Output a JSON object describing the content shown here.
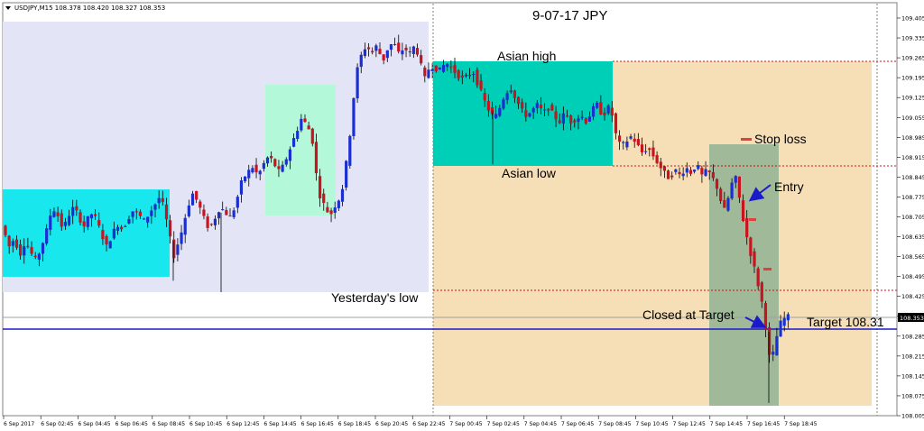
{
  "header": {
    "symbol_line": "USDJPY,M15  108.378 108.420 108.327 108.353",
    "title": "9-07-17  JPY"
  },
  "colors": {
    "bull_candle": "#1a2fd0",
    "bear_candle": "#c8141e",
    "prev_session": "#e4e4f7",
    "prev_asian": "#19e7ee",
    "prev_box2": "#b4f8da",
    "asian_box": "#00cfb7",
    "day_zone": "#f6dfb6",
    "trade_box": "#9fb999",
    "level_line": "#d01010",
    "target_line": "#1a1ac8"
  },
  "annotations": {
    "asian_high": "Asian high",
    "asian_low": "Asian low",
    "yesterdays_low": "Yesterday's low",
    "stop_loss": "Stop loss",
    "entry": "Entry",
    "closed_at_target": "Closed at Target",
    "target": "Target  108.31"
  },
  "chart_data": {
    "type": "candlestick",
    "title": "9-07-17  JPY",
    "symbol": "USDJPY,M15",
    "ylim": [
      108.0,
      109.38
    ],
    "y_ticks": [
      "109.405",
      "109.335",
      "109.265",
      "109.195",
      "109.125",
      "109.055",
      "108.985",
      "108.915",
      "108.845",
      "108.775",
      "108.705",
      "108.635",
      "108.565",
      "108.495",
      "108.425",
      "108.353",
      "108.285",
      "108.215",
      "108.145",
      "108.075",
      "108.005"
    ],
    "current_price_label": "108.353",
    "x_ticks": [
      "6 Sep 2017",
      "6 Sep 02:45",
      "6 Sep 04:45",
      "6 Sep 06:45",
      "6 Sep 08:45",
      "6 Sep 10:45",
      "6 Sep 12:45",
      "6 Sep 14:45",
      "6 Sep 16:45",
      "6 Sep 18:45",
      "6 Sep 20:45",
      "6 Sep 22:45",
      "7 Sep 00:45",
      "7 Sep 02:45",
      "7 Sep 04:45",
      "7 Sep 06:45",
      "7 Sep 08:45",
      "7 Sep 10:45",
      "7 Sep 12:45",
      "7 Sep 14:45",
      "7 Sep 16:45",
      "7 Sep 18:45"
    ],
    "levels": {
      "asian_high": 109.265,
      "asian_low": 108.895,
      "yesterdays_low": 108.44,
      "target": 108.31,
      "current_price": 108.353,
      "stop_loss": 108.965,
      "entry_marks": [
        108.705,
        108.525
      ]
    },
    "path": [
      [
        0,
        108.7
      ],
      [
        6,
        108.66
      ],
      [
        12,
        108.6
      ],
      [
        18,
        108.63
      ],
      [
        24,
        108.57
      ],
      [
        30,
        108.62
      ],
      [
        36,
        108.58
      ],
      [
        42,
        108.55
      ],
      [
        48,
        108.6
      ],
      [
        54,
        108.66
      ],
      [
        60,
        108.74
      ],
      [
        66,
        108.71
      ],
      [
        72,
        108.66
      ],
      [
        78,
        108.71
      ],
      [
        84,
        108.74
      ],
      [
        90,
        108.7
      ],
      [
        96,
        108.67
      ],
      [
        102,
        108.72
      ],
      [
        108,
        108.7
      ],
      [
        114,
        108.65
      ],
      [
        120,
        108.6
      ],
      [
        126,
        108.64
      ],
      [
        132,
        108.68
      ],
      [
        138,
        108.66
      ],
      [
        144,
        108.7
      ],
      [
        150,
        108.73
      ],
      [
        156,
        108.71
      ],
      [
        162,
        108.69
      ],
      [
        168,
        108.72
      ],
      [
        174,
        108.75
      ],
      [
        180,
        108.78
      ],
      [
        186,
        108.7
      ],
      [
        190,
        108.64
      ],
      [
        194,
        108.56
      ],
      [
        198,
        108.6
      ],
      [
        204,
        108.66
      ],
      [
        210,
        108.74
      ],
      [
        216,
        108.79
      ],
      [
        222,
        108.75
      ],
      [
        228,
        108.7
      ],
      [
        234,
        108.66
      ],
      [
        240,
        108.7
      ],
      [
        246,
        108.74
      ],
      [
        252,
        108.72
      ],
      [
        258,
        108.7
      ],
      [
        264,
        108.76
      ],
      [
        270,
        108.83
      ],
      [
        276,
        108.86
      ],
      [
        282,
        108.88
      ],
      [
        288,
        108.85
      ],
      [
        294,
        108.89
      ],
      [
        300,
        108.92
      ],
      [
        306,
        108.89
      ],
      [
        312,
        108.86
      ],
      [
        318,
        108.9
      ],
      [
        324,
        108.95
      ],
      [
        330,
        109.0
      ],
      [
        336,
        109.05
      ],
      [
        342,
        109.03
      ],
      [
        346,
        109.0
      ],
      [
        350,
        108.95
      ],
      [
        354,
        108.8
      ],
      [
        358,
        108.77
      ],
      [
        362,
        108.74
      ],
      [
        368,
        108.71
      ],
      [
        374,
        108.75
      ],
      [
        380,
        108.78
      ],
      [
        384,
        108.85
      ],
      [
        388,
        108.95
      ],
      [
        392,
        109.05
      ],
      [
        396,
        109.2
      ],
      [
        402,
        109.27
      ],
      [
        408,
        109.31
      ],
      [
        414,
        109.28
      ],
      [
        420,
        109.31
      ],
      [
        426,
        109.25
      ],
      [
        432,
        109.3
      ],
      [
        438,
        109.32
      ],
      [
        444,
        109.28
      ],
      [
        450,
        109.3
      ],
      [
        456,
        109.28
      ],
      [
        462,
        109.31
      ],
      [
        466,
        109.27
      ],
      [
        470,
        109.22
      ],
      [
        474,
        109.18
      ],
      [
        478,
        109.24
      ],
      [
        484,
        109.23
      ],
      [
        490,
        109.22
      ],
      [
        496,
        109.25
      ],
      [
        502,
        109.23
      ],
      [
        508,
        109.21
      ],
      [
        514,
        109.19
      ],
      [
        520,
        109.2
      ],
      [
        526,
        109.22
      ],
      [
        532,
        109.17
      ],
      [
        538,
        109.12
      ],
      [
        544,
        109.08
      ],
      [
        550,
        109.05
      ],
      [
        556,
        109.09
      ],
      [
        562,
        109.14
      ],
      [
        568,
        109.16
      ],
      [
        574,
        109.12
      ],
      [
        580,
        109.08
      ],
      [
        586,
        109.06
      ],
      [
        592,
        109.08
      ],
      [
        598,
        109.1
      ],
      [
        604,
        109.07
      ],
      [
        610,
        109.09
      ],
      [
        616,
        109.06
      ],
      [
        622,
        109.04
      ],
      [
        628,
        109.07
      ],
      [
        634,
        109.04
      ],
      [
        640,
        109.05
      ],
      [
        646,
        109.06
      ],
      [
        652,
        109.04
      ],
      [
        658,
        109.08
      ],
      [
        664,
        109.1
      ],
      [
        670,
        109.06
      ],
      [
        676,
        109.09
      ],
      [
        680,
        109.07
      ],
      [
        684,
        109.0
      ],
      [
        690,
        108.95
      ],
      [
        696,
        108.97
      ],
      [
        702,
        108.99
      ],
      [
        708,
        108.96
      ],
      [
        714,
        108.93
      ],
      [
        720,
        108.95
      ],
      [
        726,
        108.92
      ],
      [
        732,
        108.89
      ],
      [
        738,
        108.86
      ],
      [
        744,
        108.84
      ],
      [
        750,
        108.87
      ],
      [
        756,
        108.85
      ],
      [
        762,
        108.88
      ],
      [
        768,
        108.86
      ],
      [
        774,
        108.89
      ],
      [
        780,
        108.85
      ],
      [
        786,
        108.87
      ],
      [
        792,
        108.84
      ],
      [
        798,
        108.8
      ],
      [
        804,
        108.72
      ],
      [
        810,
        108.78
      ],
      [
        816,
        108.86
      ],
      [
        820,
        108.8
      ],
      [
        824,
        108.72
      ],
      [
        828,
        108.66
      ],
      [
        832,
        108.6
      ],
      [
        836,
        108.55
      ],
      [
        840,
        108.5
      ],
      [
        844,
        108.44
      ],
      [
        848,
        108.38
      ],
      [
        852,
        108.28
      ],
      [
        856,
        108.18
      ],
      [
        860,
        108.24
      ],
      [
        864,
        108.3
      ],
      [
        868,
        108.34
      ],
      [
        874,
        108.353
      ]
    ]
  }
}
